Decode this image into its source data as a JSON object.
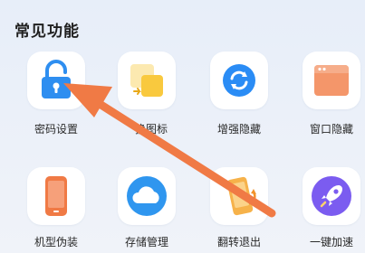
{
  "section": {
    "title": "常见功能"
  },
  "features": [
    {
      "label": "密码设置",
      "icon": "padlock-icon"
    },
    {
      "label": "换图标",
      "icon": "swap-icon"
    },
    {
      "label": "增强隐藏",
      "icon": "sync-icon"
    },
    {
      "label": "窗口隐藏",
      "icon": "window-icon"
    },
    {
      "label": "机型伪装",
      "icon": "phone-icon"
    },
    {
      "label": "存储管理",
      "icon": "cloud-icon"
    },
    {
      "label": "翻转退出",
      "icon": "flip-phone-icon"
    },
    {
      "label": "一键加速",
      "icon": "rocket-icon"
    }
  ],
  "colors": {
    "annotation_arrow": "#f07a45",
    "padlock": "#2e8ef0",
    "swap": "#f9c93e",
    "sync": "#2a8cf5",
    "window": "#f4966a",
    "phone": "#f07a45",
    "cloud": "#2f96ef",
    "rocket": "#7b5cf0"
  }
}
